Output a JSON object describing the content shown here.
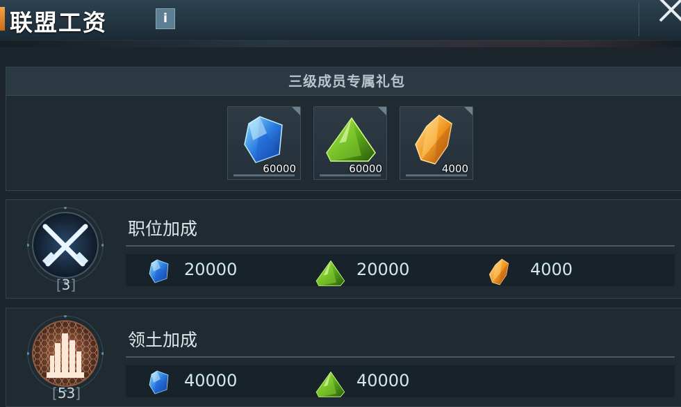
{
  "header": {
    "title": "联盟工资",
    "info_label": "i"
  },
  "gift": {
    "title": "三级成员专属礼包",
    "items": [
      {
        "icon": "blue-crystal-icon",
        "count": "60000"
      },
      {
        "icon": "green-gem-icon",
        "count": "60000"
      },
      {
        "icon": "gold-crystal-icon",
        "count": "4000"
      }
    ]
  },
  "position_bonus": {
    "title": "职位加成",
    "level": "3",
    "icon": "crossed-guns-icon",
    "rewards": [
      {
        "icon": "blue-crystal-icon",
        "value": "20000"
      },
      {
        "icon": "green-gem-icon",
        "value": "20000"
      },
      {
        "icon": "gold-crystal-icon",
        "value": "4000"
      }
    ]
  },
  "territory_bonus": {
    "title": "领土加成",
    "level": "53",
    "icon": "domed-city-icon",
    "rewards": [
      {
        "icon": "blue-crystal-icon",
        "value": "40000"
      },
      {
        "icon": "green-gem-icon",
        "value": "40000"
      }
    ]
  },
  "colors": {
    "accent": "#f3a34a",
    "value_text": "#cfe9ef",
    "background": "#1c252c"
  }
}
